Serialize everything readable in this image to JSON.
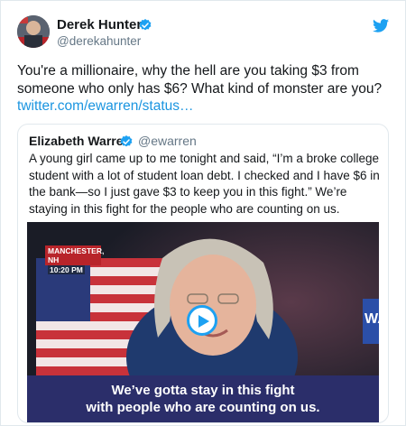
{
  "tweet": {
    "author_name": "Derek Hunter",
    "author_handle": "@derekahunter",
    "text": "You're a millionaire, why the hell are you taking $3 from someone who only has $6? What kind of monster are you?",
    "link": "twitter.com/ewarren/status…"
  },
  "quoted_tweet": {
    "author_name": "Elizabeth Warren",
    "author_handle": "@ewarren",
    "text": "A young girl came up to me tonight and said, “I’m a broke college student with a lot of student loan debt. I checked and I have $6 in the bank—so I just gave $3 to keep you in this fight.” We’re staying in this fight for the people who are counting on us.",
    "video": {
      "locator_place": "MANCHESTER, NH",
      "locator_time": "10:20 PM",
      "caption_line1": "We’ve gotta stay in this fight",
      "caption_line2": "with people who are counting on us.",
      "sign_text": "WA"
    }
  },
  "colors": {
    "verified": "#1da1f2",
    "link": "#1b95e0",
    "caption_bg": "#2b2e6a",
    "locator_bg": "#b8242a"
  },
  "icons": [
    "verified-badge-icon",
    "twitter-bird-icon",
    "play-icon"
  ]
}
